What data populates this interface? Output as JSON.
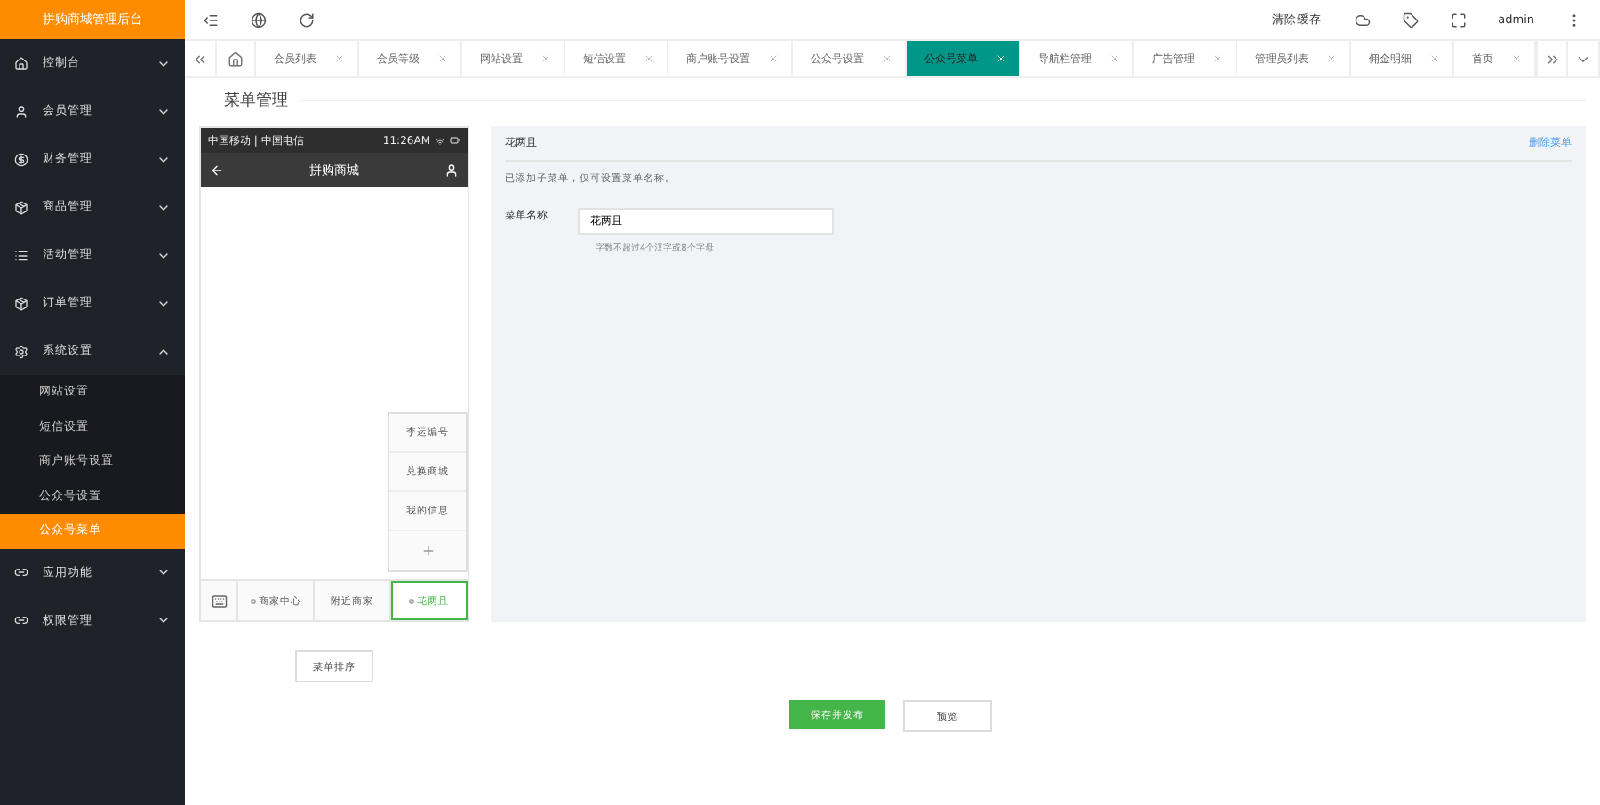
{
  "brand": "拼购商城管理后台",
  "sidebar": {
    "items": [
      {
        "label": "控制台",
        "expanded": false
      },
      {
        "label": "会员管理",
        "expanded": false
      },
      {
        "label": "财务管理",
        "expanded": false
      },
      {
        "label": "商品管理",
        "expanded": false
      },
      {
        "label": "活动管理",
        "expanded": false
      },
      {
        "label": "订单管理",
        "expanded": false
      },
      {
        "label": "系统设置",
        "expanded": true,
        "children": [
          {
            "label": "网站设置",
            "selected": false
          },
          {
            "label": "短信设置",
            "selected": false
          },
          {
            "label": "商户账号设置",
            "selected": false
          },
          {
            "label": "公众号设置",
            "selected": false
          },
          {
            "label": "公众号菜单",
            "selected": true
          }
        ]
      },
      {
        "label": "应用功能",
        "expanded": false
      },
      {
        "label": "权限管理",
        "expanded": false
      }
    ]
  },
  "header": {
    "clear_cache": "清除缓存",
    "user": "admin"
  },
  "tabs": [
    {
      "label": "会员列表",
      "selected": false
    },
    {
      "label": "会员等级",
      "selected": false
    },
    {
      "label": "网站设置",
      "selected": false
    },
    {
      "label": "短信设置",
      "selected": false
    },
    {
      "label": "商户账号设置",
      "selected": false
    },
    {
      "label": "公众号设置",
      "selected": false
    },
    {
      "label": "公众号菜单",
      "selected": true
    },
    {
      "label": "导航栏管理",
      "selected": false
    },
    {
      "label": "广告管理",
      "selected": false
    },
    {
      "label": "管理员列表",
      "selected": false
    },
    {
      "label": "佣金明细",
      "selected": false
    },
    {
      "label": "首页",
      "selected": false
    }
  ],
  "page_title": "菜单管理",
  "phone": {
    "carrier": "中国移动 | 中国电信",
    "time": "11:26AM",
    "title": "拼购商城",
    "menu": [
      {
        "label": "商家中心",
        "has_submenu": true,
        "selected": false
      },
      {
        "label": "附近商家",
        "has_submenu": false,
        "selected": false
      },
      {
        "label": "花两且",
        "has_submenu": true,
        "selected": true,
        "children": [
          "李运编号",
          "兑换商城",
          "我的信息"
        ]
      }
    ]
  },
  "editor": {
    "title": "花两且",
    "delete_link": "删除菜单",
    "notice": "已添加子菜单，仅可设置菜单名称。",
    "name_label": "菜单名称",
    "name_value": "花两且",
    "hint": "字数不超过4个汉字或8个字母"
  },
  "buttons": {
    "sort": "菜单排序",
    "save": "保存并发布",
    "preview": "预览"
  }
}
